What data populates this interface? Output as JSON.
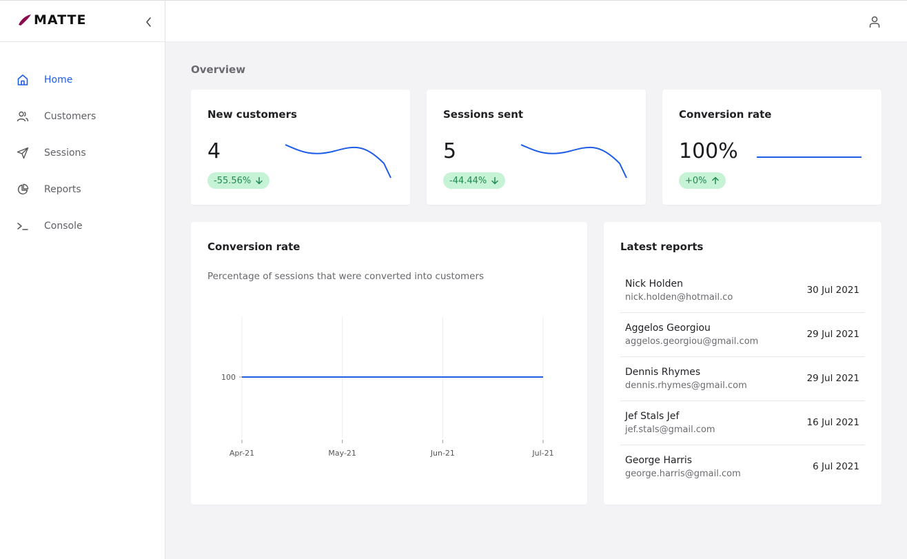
{
  "app": {
    "brand": "MATTE",
    "colors": {
      "accent": "#1c5ce6",
      "brand_mark": "#8a0a4f",
      "badge_bg": "#c6f2d6",
      "badge_text": "#218a4f"
    }
  },
  "sidebar": {
    "collapse_icon": "chevron-left-icon",
    "items": [
      {
        "label": "Home",
        "icon": "home-icon",
        "active": true
      },
      {
        "label": "Customers",
        "icon": "users-icon",
        "active": false
      },
      {
        "label": "Sessions",
        "icon": "send-icon",
        "active": false
      },
      {
        "label": "Reports",
        "icon": "pie-chart-icon",
        "active": false
      },
      {
        "label": "Console",
        "icon": "terminal-icon",
        "active": false
      }
    ]
  },
  "topbar": {
    "user_icon": "user-icon"
  },
  "main": {
    "title": "Overview",
    "kpis": [
      {
        "title": "New customers",
        "value": "4",
        "change": "-55.56%",
        "direction": "down",
        "trend": [
          6,
          4.5,
          6,
          1
        ]
      },
      {
        "title": "Sessions sent",
        "value": "5",
        "change": "-44.44%",
        "direction": "down",
        "trend": [
          6,
          4.5,
          6,
          1
        ]
      },
      {
        "title": "Conversion rate",
        "value": "100%",
        "change": "+0%",
        "direction": "up",
        "trend": [
          100,
          100,
          100,
          100
        ]
      }
    ],
    "conversion_chart": {
      "title": "Conversion rate",
      "subtitle": "Percentage of sessions that were converted into customers"
    },
    "latest_reports": {
      "title": "Latest reports",
      "rows": [
        {
          "name": "Nick Holden",
          "email": "nick.holden@hotmail.co",
          "date": "30 Jul 2021"
        },
        {
          "name": "Aggelos Georgiou",
          "email": "aggelos.georgiou@gmail.com",
          "date": "29 Jul 2021"
        },
        {
          "name": "Dennis Rhymes",
          "email": "dennis.rhymes@gmail.com",
          "date": "29 Jul 2021"
        },
        {
          "name": "Jef Stals Jef",
          "email": "jef.stals@gmail.com",
          "date": "16 Jul 2021"
        },
        {
          "name": "George Harris",
          "email": "george.harris@gmail.com",
          "date": "6 Jul 2021"
        }
      ]
    }
  },
  "chart_data": {
    "type": "line",
    "title": "Conversion rate",
    "subtitle": "Percentage of sessions that were converted into customers",
    "xlabel": "",
    "ylabel": "",
    "categories": [
      "Apr-21",
      "May-21",
      "Jun-21",
      "Jul-21"
    ],
    "series": [
      {
        "name": "Conversion rate",
        "values": [
          100,
          100,
          100,
          100
        ]
      }
    ],
    "yticks": [
      100
    ],
    "ylim": [
      0,
      200
    ],
    "grid": "vertical",
    "legend": "none"
  }
}
